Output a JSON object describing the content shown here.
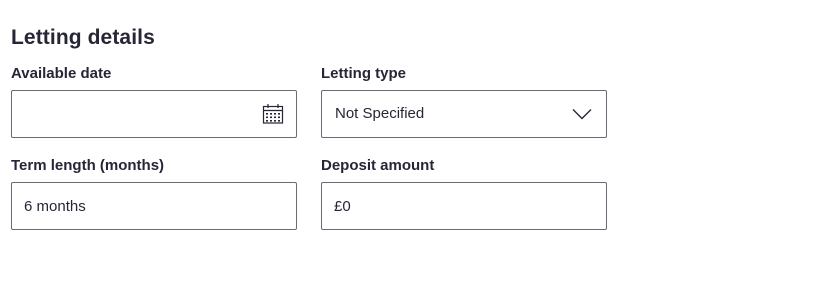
{
  "section": {
    "title": "Letting details"
  },
  "fields": {
    "available_date": {
      "label": "Available date",
      "value": "",
      "icon": "calendar-icon"
    },
    "letting_type": {
      "label": "Letting type",
      "selected": "Not Specified",
      "icon": "chevron-down-icon"
    },
    "term_length": {
      "label": "Term length (months)",
      "value": "6 months"
    },
    "deposit_amount": {
      "label": "Deposit amount",
      "value": "£0"
    }
  },
  "colors": {
    "text": "#262637",
    "border": "#6a6a78",
    "background": "#ffffff"
  }
}
